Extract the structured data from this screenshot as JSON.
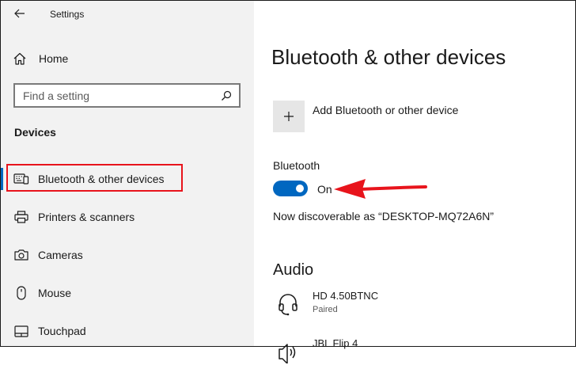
{
  "window": {
    "title": "Settings"
  },
  "sidebar": {
    "home_label": "Home",
    "search_placeholder": "Find a setting",
    "section_label": "Devices",
    "items": [
      {
        "label": "Bluetooth & other devices",
        "icon": "bluetooth-devices-icon",
        "selected": true
      },
      {
        "label": "Printers & scanners",
        "icon": "printer-icon"
      },
      {
        "label": "Cameras",
        "icon": "camera-icon"
      },
      {
        "label": "Mouse",
        "icon": "mouse-icon"
      },
      {
        "label": "Touchpad",
        "icon": "touchpad-icon"
      }
    ]
  },
  "main": {
    "title": "Bluetooth & other devices",
    "add_device_label": "Add Bluetooth or other device",
    "bluetooth": {
      "label": "Bluetooth",
      "toggle_text": "On",
      "enabled": true
    },
    "discoverable_text": "Now discoverable as “DESKTOP-MQ72A6N”",
    "audio": {
      "heading": "Audio",
      "devices": [
        {
          "name": "HD 4.50BTNC",
          "status": "Paired",
          "icon": "headset-icon"
        },
        {
          "name": "JBL Flip 4",
          "status": "",
          "icon": "speaker-icon"
        }
      ]
    }
  },
  "colors": {
    "accent": "#0067c0",
    "sidebar_bg": "#f2f2f2",
    "annotation_red": "#e8141c"
  }
}
